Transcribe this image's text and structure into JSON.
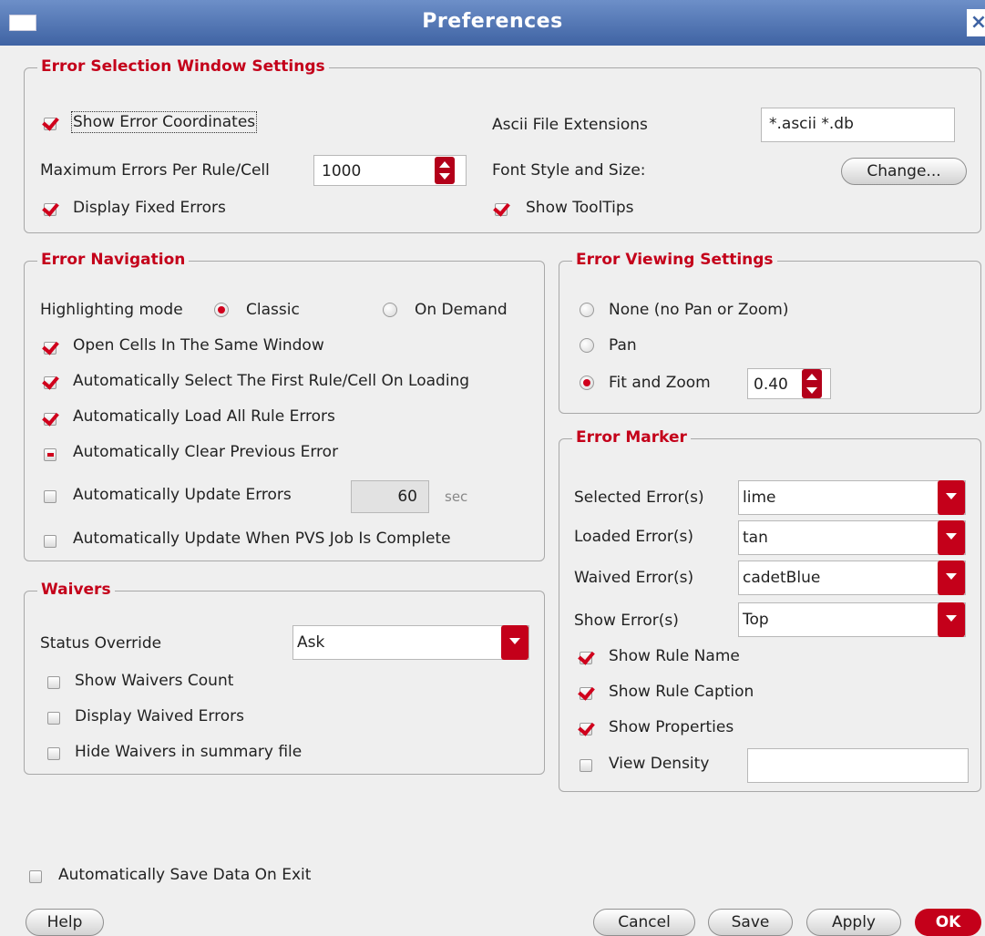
{
  "window": {
    "title": "Preferences",
    "close_glyph": "×"
  },
  "error_selection": {
    "title": "Error Selection Window Settings",
    "show_error_coordinates": "Show Error Coordinates",
    "ascii_ext_label": "Ascii File Extensions",
    "ascii_ext_value": "*.ascii *.db",
    "max_errors_label": "Maximum Errors Per Rule/Cell",
    "max_errors_value": "1000",
    "font_label": "Font Style and Size:",
    "change_button": "Change...",
    "display_fixed_errors": "Display Fixed Errors",
    "show_tooltips": "Show ToolTips"
  },
  "error_navigation": {
    "title": "Error Navigation",
    "highlighting_label": "Highlighting mode",
    "classic": "Classic",
    "on_demand": "On Demand",
    "open_cells": "Open Cells In The Same Window",
    "auto_select_first": "Automatically Select The First Rule/Cell On Loading",
    "auto_load": "Automatically Load All Rule Errors",
    "auto_clear": "Automatically Clear Previous Error",
    "auto_update": "Automatically Update Errors",
    "update_interval": "60",
    "update_unit": "sec",
    "auto_update_pvs": "Automatically Update When PVS Job Is Complete"
  },
  "error_viewing": {
    "title": "Error Viewing Settings",
    "none": "None (no Pan or Zoom)",
    "pan": "Pan",
    "fit_zoom": "Fit and Zoom",
    "zoom_value": "0.40"
  },
  "error_marker": {
    "title": "Error Marker",
    "selected_label": "Selected Error(s)",
    "selected_value": "lime",
    "loaded_label": "Loaded Error(s)",
    "loaded_value": "tan",
    "waived_label": "Waived Error(s)",
    "waived_value": "cadetBlue",
    "show_label": "Show Error(s)",
    "show_value": "Top",
    "show_rule_name": "Show Rule Name",
    "show_rule_caption": "Show Rule Caption",
    "show_properties": "Show Properties",
    "view_density": "View Density",
    "view_density_value": ""
  },
  "waivers": {
    "title": "Waivers",
    "status_override_label": "Status Override",
    "status_override_value": "Ask",
    "show_waivers_count": "Show Waivers Count",
    "display_waived": "Display Waived Errors",
    "hide_waivers": "Hide Waivers in summary file"
  },
  "footer": {
    "auto_save": "Automatically Save Data On Exit",
    "help": "Help",
    "cancel": "Cancel",
    "save": "Save",
    "apply": "Apply",
    "ok": "OK"
  },
  "colors": {
    "accent": "#c4001a",
    "title_bar": "#3f63a3",
    "background": "#efefef"
  }
}
